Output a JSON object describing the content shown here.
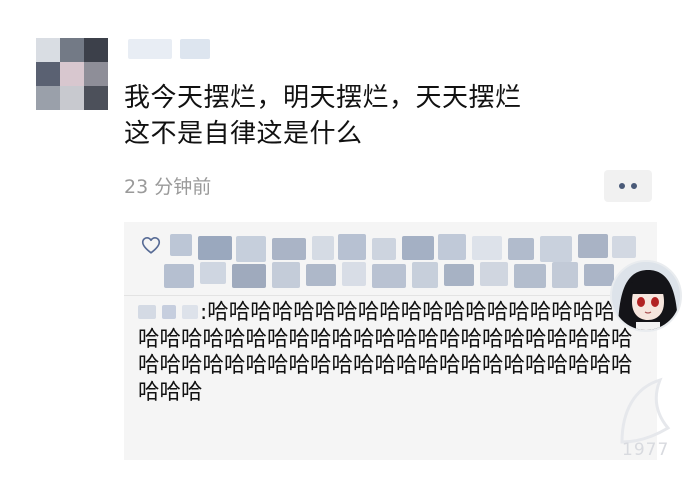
{
  "post": {
    "text_line1": "我今天摆烂，明天摆烂，天天摆烂",
    "text_line2": "这不是自律这是什么",
    "time": "23 分钟前"
  },
  "comment": {
    "separator": ":",
    "text": "哈哈哈哈哈哈哈哈哈哈哈哈哈哈哈哈哈哈哈哈哈哈哈哈哈哈哈哈哈哈哈哈哈哈哈哈哈哈哈哈哈哈哈哈哈哈哈哈哈哈哈哈哈哈哈哈哈哈哈哈哈哈哈哈哈哈哈哈哈"
  },
  "watermark": {
    "number": "1977"
  },
  "colors": {
    "time_gray": "#9a9a9a",
    "comment_bg": "#f5f5f5",
    "link_blue": "#576b95"
  },
  "icons": {
    "like": "heart-outline-icon",
    "more": "more-dots-icon"
  }
}
